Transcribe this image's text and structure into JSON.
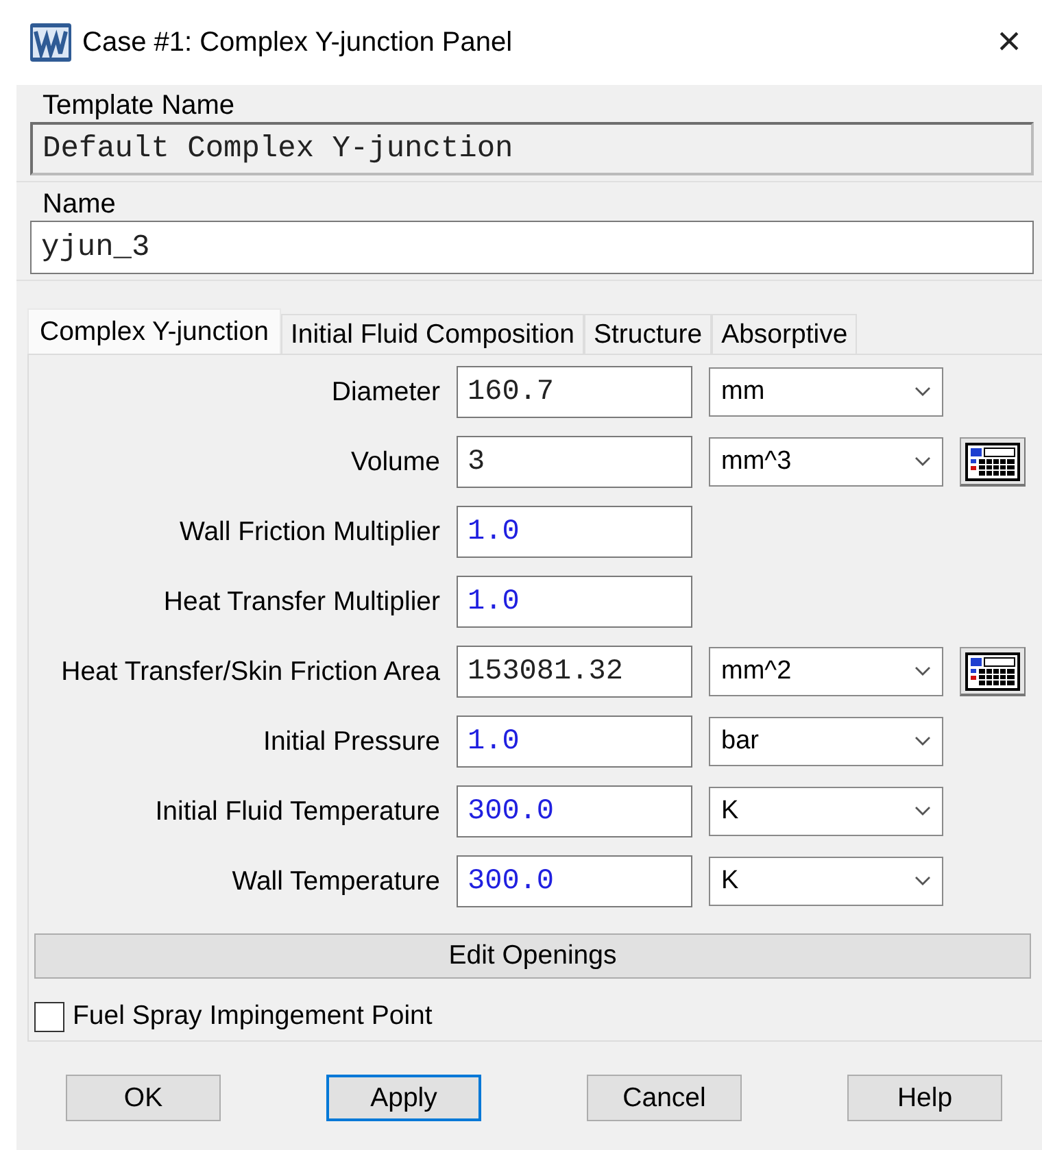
{
  "window": {
    "title": "Case #1: Complex Y-junction Panel",
    "close": "×"
  },
  "template_name": {
    "label": "Template Name",
    "value": "Default Complex Y-junction",
    "read_only": true
  },
  "name": {
    "label": "Name",
    "value": "yjun_3",
    "read_only": false
  },
  "tabs": [
    {
      "label": "Complex Y-junction",
      "selected": true
    },
    {
      "label": "Initial Fluid Composition",
      "selected": false
    },
    {
      "label": "Structure",
      "selected": false
    },
    {
      "label": "Absorptive",
      "selected": false
    }
  ],
  "rows": [
    {
      "label": "Diameter",
      "value": "160.7",
      "default_value": false,
      "unit": "mm",
      "calculator": false
    },
    {
      "label": "Volume",
      "value": "3",
      "default_value": false,
      "unit": "mm^3",
      "calculator": true
    },
    {
      "label": "Wall Friction Multiplier",
      "value": "1.0",
      "default_value": true,
      "calculator": false
    },
    {
      "label": "Heat Transfer Multiplier",
      "value": "1.0",
      "default_value": true,
      "calculator": false
    },
    {
      "label": "Heat Transfer/Skin Friction Area",
      "value": "153081.32",
      "default_value": false,
      "unit": "mm^2",
      "calculator": true
    },
    {
      "label": "Initial Pressure",
      "value": "1.0",
      "default_value": true,
      "unit": "bar",
      "calculator": false
    },
    {
      "label": "Initial Fluid Temperature",
      "value": "300.0",
      "default_value": true,
      "unit": "K",
      "calculator": false
    },
    {
      "label": "Wall Temperature",
      "value": "300.0",
      "default_value": true,
      "unit": "K",
      "calculator": false
    }
  ],
  "edit_openings": "Edit Openings",
  "fuel_spray": {
    "label": "Fuel Spray Impingement Point",
    "checked": false
  },
  "buttons": [
    {
      "label": "OK",
      "focused": false
    },
    {
      "label": "Apply",
      "focused": true
    },
    {
      "label": "Cancel",
      "focused": false
    },
    {
      "label": "Help",
      "focused": false
    }
  ]
}
